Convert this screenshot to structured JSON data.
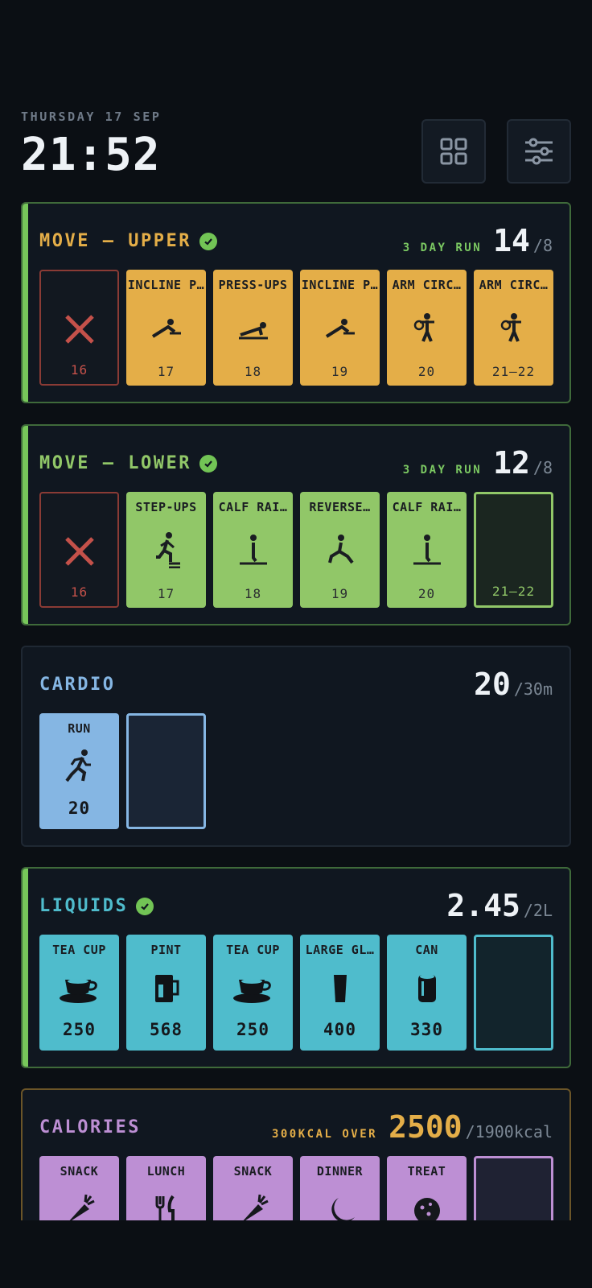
{
  "header": {
    "date": "THURSDAY 17 SEP",
    "time": "21:52"
  },
  "upper": {
    "title": "MOVE — UPPER",
    "streak": "3 DAY RUN",
    "value": "14",
    "unit": "/8",
    "tiles": [
      {
        "label": "",
        "value": "16",
        "icon": "miss-icon"
      },
      {
        "label": "INCLINE P…",
        "value": "17",
        "icon": "incline-pushup-icon"
      },
      {
        "label": "PRESS-UPS",
        "value": "18",
        "icon": "pushup-icon"
      },
      {
        "label": "INCLINE P…",
        "value": "19",
        "icon": "incline-pushup-icon"
      },
      {
        "label": "ARM CIRC…",
        "value": "20",
        "icon": "arm-circles-icon"
      },
      {
        "label": "ARM CIRC…",
        "value": "21–22",
        "icon": "arm-circles-icon"
      }
    ]
  },
  "lower": {
    "title": "MOVE — LOWER",
    "streak": "3 DAY RUN",
    "value": "12",
    "unit": "/8",
    "tiles": [
      {
        "label": "",
        "value": "16",
        "icon": "miss-icon"
      },
      {
        "label": "STEP-UPS",
        "value": "17",
        "icon": "step-up-icon"
      },
      {
        "label": "CALF RAI…",
        "value": "18",
        "icon": "calf-raise-icon"
      },
      {
        "label": "REVERSE…",
        "value": "19",
        "icon": "lunge-icon"
      },
      {
        "label": "CALF RAI…",
        "value": "20",
        "icon": "calf-raise-icon"
      },
      {
        "label": "",
        "value": "21–22",
        "icon": ""
      }
    ]
  },
  "cardio": {
    "title": "CARDIO",
    "value": "20",
    "unit": "/30m",
    "tiles": [
      {
        "label": "RUN",
        "value": "20",
        "icon": "run-icon"
      }
    ]
  },
  "liquids": {
    "title": "LIQUIDS",
    "value": "2.45",
    "unit": "/2L",
    "tiles": [
      {
        "label": "TEA CUP",
        "value": "250",
        "icon": "tea-cup-icon"
      },
      {
        "label": "PINT",
        "value": "568",
        "icon": "pint-icon"
      },
      {
        "label": "TEA CUP",
        "value": "250",
        "icon": "tea-cup-icon"
      },
      {
        "label": "LARGE GL…",
        "value": "400",
        "icon": "glass-icon"
      },
      {
        "label": "CAN",
        "value": "330",
        "icon": "can-icon"
      }
    ]
  },
  "calories": {
    "title": "CALORIES",
    "status": "300KCAL OVER",
    "value": "2500",
    "unit": "/1900kcal",
    "tiles": [
      {
        "label": "SNACK",
        "icon": "carrot-icon"
      },
      {
        "label": "LUNCH",
        "icon": "cutlery-icon"
      },
      {
        "label": "SNACK",
        "icon": "carrot-icon"
      },
      {
        "label": "DINNER",
        "icon": "moon-icon"
      },
      {
        "label": "TREAT",
        "icon": "cookie-icon"
      }
    ]
  },
  "colors": {
    "orange": "#e4ae48",
    "green": "#91c768",
    "blue": "#85b6e3",
    "cyan": "#4fbccc",
    "purple": "#bd8fd4",
    "miss": "#c4514a",
    "background": "#0b0f14"
  }
}
